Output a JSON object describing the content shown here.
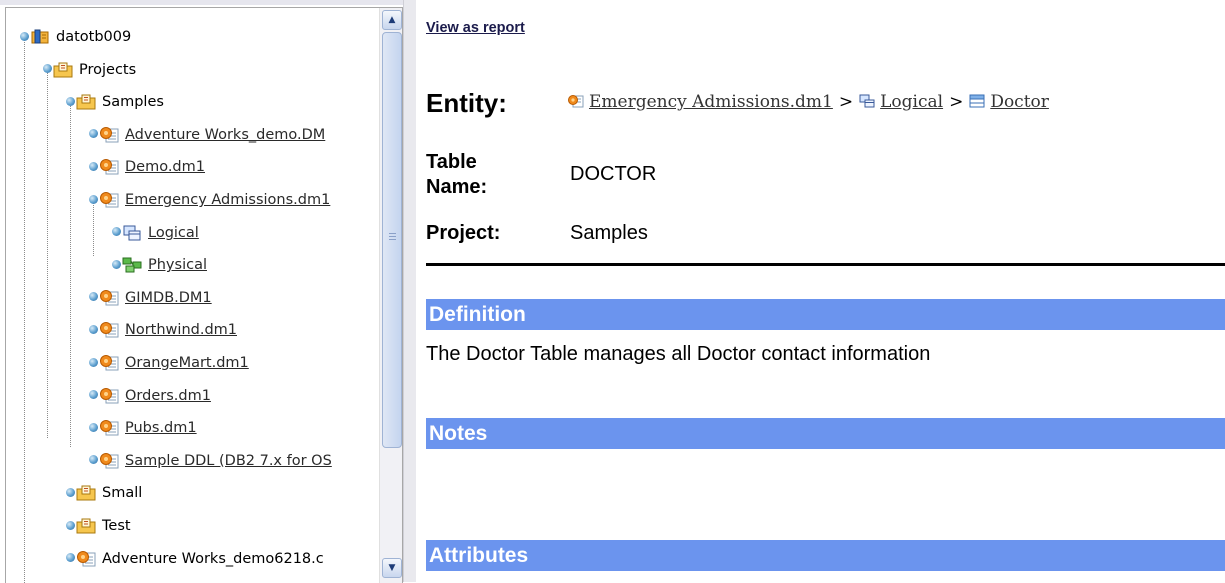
{
  "tree": {
    "items": [
      {
        "label": "datotb009",
        "icon": "server-icon",
        "link": false
      },
      {
        "label": "Projects",
        "icon": "folder-icon",
        "link": false
      },
      {
        "label": "Samples",
        "icon": "folder-icon",
        "link": false
      },
      {
        "label": "Adventure Works_demo.DM",
        "icon": "model-file-icon",
        "link": true
      },
      {
        "label": "Demo.dm1",
        "icon": "model-file-icon",
        "link": true
      },
      {
        "label": "Emergency Admissions.dm1",
        "icon": "model-file-icon",
        "link": true
      },
      {
        "label": "Logical",
        "icon": "logical-model-icon",
        "link": true
      },
      {
        "label": "Physical",
        "icon": "physical-model-icon",
        "link": true
      },
      {
        "label": "GIMDB.DM1",
        "icon": "model-file-icon",
        "link": true
      },
      {
        "label": "Northwind.dm1",
        "icon": "model-file-icon",
        "link": true
      },
      {
        "label": "OrangeMart.dm1",
        "icon": "model-file-icon",
        "link": true
      },
      {
        "label": "Orders.dm1",
        "icon": "model-file-icon",
        "link": true
      },
      {
        "label": "Pubs.dm1",
        "icon": "model-file-icon",
        "link": true
      },
      {
        "label": "Sample DDL (DB2 7.x for OS",
        "icon": "model-file-icon",
        "link": true
      },
      {
        "label": "Small",
        "icon": "folder-icon",
        "link": false
      },
      {
        "label": "Test",
        "icon": "folder-icon",
        "link": false
      },
      {
        "label": "Adventure Works_demo6218.c",
        "icon": "model-file-icon",
        "link": false
      }
    ]
  },
  "report": {
    "view_as_report": "View as report",
    "entity_label": "Entity:",
    "breadcrumb": {
      "model": "Emergency Admissions.dm1",
      "submodel": "Logical",
      "entity": "Doctor",
      "separator": ">"
    },
    "table_name_label_1": "Table",
    "table_name_label_2": "Name:",
    "table_name_value": "DOCTOR",
    "project_label": "Project:",
    "project_value": "Samples",
    "sections": {
      "definition_title": "Definition",
      "definition_text": "The Doctor Table manages all Doctor contact information",
      "notes_title": "Notes",
      "attributes_title": "Attributes"
    }
  },
  "colors": {
    "section_bar": "#6b94ee",
    "scrollbar_accent": "#c4d4ef"
  }
}
